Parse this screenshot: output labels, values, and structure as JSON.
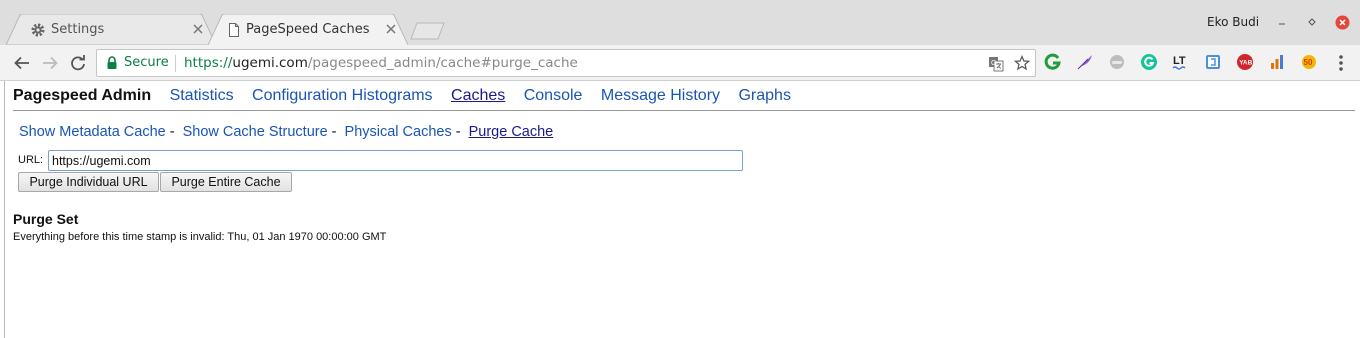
{
  "browser": {
    "tabs": [
      {
        "title": "Settings",
        "icon": "gear-icon",
        "active": false
      },
      {
        "title": "PageSpeed Caches",
        "icon": "page-icon",
        "active": true
      }
    ],
    "profile_name": "Eko Budi",
    "security_label": "Secure",
    "url": {
      "scheme": "https://",
      "host": "ugemi.com",
      "path": "/pagespeed_admin/cache#purge_cache"
    },
    "extensions": [
      "grammarly-g-icon",
      "feather-icon",
      "ghostery-icon",
      "grammarly-icon",
      "languagetool-icon",
      "extension-bracket-icon",
      "yab-icon",
      "analytics-icon",
      "honey-icon"
    ],
    "accent_colors": {
      "secure": "#0b8043",
      "link": "#1a54b4",
      "visited": "#1a1a8c",
      "close": "#e4463b"
    }
  },
  "page": {
    "brand": "Pagespeed Admin",
    "nav": [
      {
        "label": "Statistics",
        "active": false
      },
      {
        "label": "Configuration Histograms",
        "active": false
      },
      {
        "label": "Caches",
        "active": true
      },
      {
        "label": "Console",
        "active": false
      },
      {
        "label": "Message History",
        "active": false
      },
      {
        "label": "Graphs",
        "active": false
      }
    ],
    "subnav": [
      {
        "label": "Show Metadata Cache",
        "active": false
      },
      {
        "label": "Show Cache Structure",
        "active": false
      },
      {
        "label": "Physical Caches",
        "active": false
      },
      {
        "label": "Purge Cache",
        "active": true
      }
    ],
    "subnav_separator": "-",
    "url_label": "URL:",
    "url_value": "https://ugemi.com",
    "purge_individual_label": "Purge Individual URL",
    "purge_entire_label": "Purge Entire Cache",
    "purge_set_title": "Purge Set",
    "purge_set_text": "Everything before this time stamp is invalid: Thu, 01 Jan 1970 00:00:00 GMT"
  }
}
